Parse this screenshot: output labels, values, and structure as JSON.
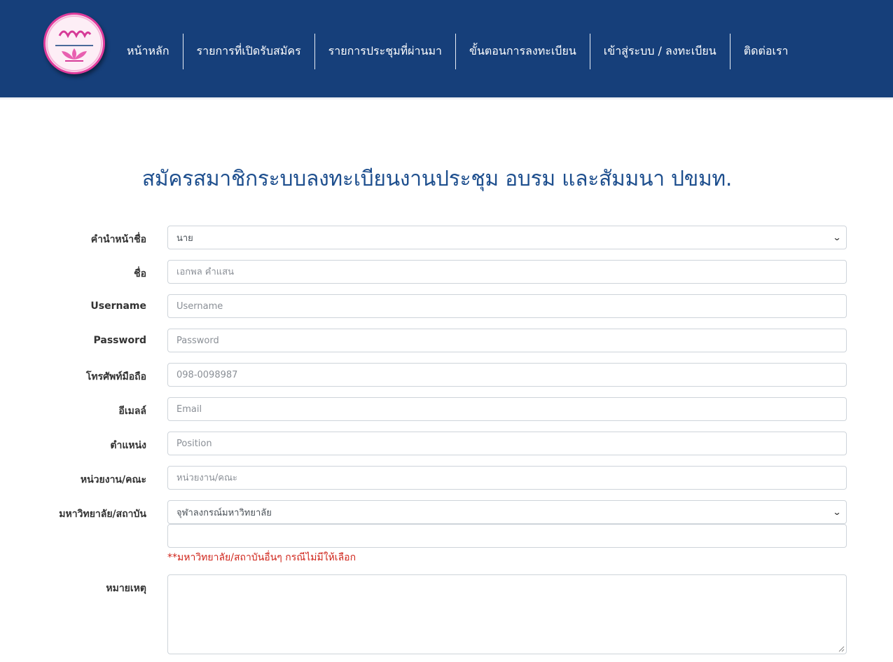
{
  "nav": {
    "items": [
      {
        "label": "หน้าหลัก"
      },
      {
        "label": "รายการที่เปิดรับสมัคร"
      },
      {
        "label": "รายการประชุมที่ผ่านมา"
      },
      {
        "label": "ขั้นตอนการลงทะเบียน"
      },
      {
        "label": "เข้าสู่ระบบ / ลงทะเบียน"
      },
      {
        "label": "ติดต่อเรา"
      }
    ]
  },
  "page": {
    "title": "สมัครสมาชิกระบบลงทะเบียนงานประชุม อบรม และสัมมนา ปขมท."
  },
  "form": {
    "prefix": {
      "label": "คำนำหน้าชื่อ",
      "value": "นาย"
    },
    "name": {
      "label": "ชื่อ",
      "placeholder": "เอกพล คำแสน"
    },
    "username": {
      "label": "Username",
      "placeholder": "Username"
    },
    "password": {
      "label": "Password",
      "placeholder": "Password"
    },
    "phone": {
      "label": "โทรศัพท์มือถือ",
      "placeholder": "098-0098987"
    },
    "email": {
      "label": "อีเมลล์",
      "placeholder": "Email"
    },
    "position": {
      "label": "ตำแหน่ง",
      "placeholder": "Position"
    },
    "department": {
      "label": "หน่วยงาน/คณะ",
      "placeholder": "หน่วยงาน/คณะ"
    },
    "university": {
      "label": "มหาวิทยาลัย/สถาบัน",
      "value": "จุฬาลงกรณ์มหาวิทยาลัย"
    },
    "other_university": {
      "value": "",
      "hint": "**มหาวิทยาลัย/สถาบันอื่นๆ กรณีไม่มีให้เลือก"
    },
    "remark": {
      "label": "หมายเหตุ",
      "value": ""
    }
  },
  "colors": {
    "navbar": "#163f7a",
    "title": "#1e4f8e",
    "hint": "#d0261c",
    "logo_accent": "#e03c9c"
  },
  "icons": {
    "logo": "lotus-logo",
    "select_arrow": "chevron-down-icon"
  }
}
